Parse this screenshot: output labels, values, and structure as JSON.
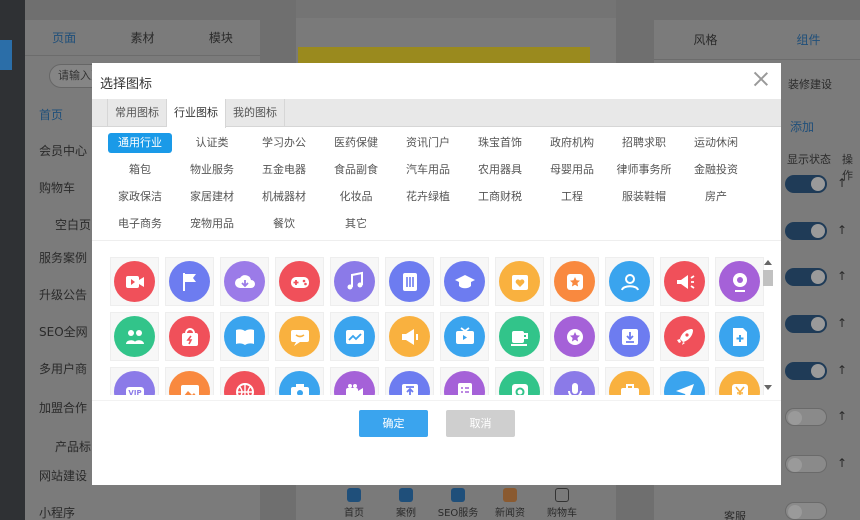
{
  "background": {
    "left_tabs": [
      "页面",
      "素材",
      "模块"
    ],
    "left_search": "请输入页",
    "left_items": [
      "首页",
      "会员中心",
      "购物车",
      "空白页",
      "服务案例",
      "升级公告",
      "SEO全网",
      "多用户商",
      "加盟合作",
      "产品标",
      "网站建设",
      "小程序"
    ],
    "right_tabs": [
      "风格",
      "组件"
    ],
    "right_items": [
      "添加",
      "显示状态",
      "操作",
      "装修建设",
      "客服"
    ],
    "bottom_nav": [
      "首页",
      "案例",
      "SEO服务",
      "新闻资",
      "购物车"
    ]
  },
  "modal": {
    "title": "选择图标",
    "close_icon": "close-icon",
    "tabs": [
      "常用图标",
      "行业图标",
      "我的图标"
    ],
    "active_tab": 1,
    "categories": [
      "通用行业",
      "认证类",
      "学习办公",
      "医药保健",
      "资讯门户",
      "珠宝首饰",
      "政府机构",
      "招聘求职",
      "运动休闲",
      "箱包",
      "物业服务",
      "五金电器",
      "食品副食",
      "汽车用品",
      "农用器具",
      "母婴用品",
      "律师事务所",
      "金融投资",
      "家政保洁",
      "家居建材",
      "机械器材",
      "化妆品",
      "花卉绿植",
      "工商财税",
      "工程",
      "服装鞋帽",
      "房产",
      "电子商务",
      "宠物用品",
      "餐饮",
      "其它"
    ],
    "active_category": 0,
    "icons": [
      {
        "name": "video-icon",
        "color": "#f0505a"
      },
      {
        "name": "flag-icon",
        "color": "#6d7cf0"
      },
      {
        "name": "cloud-icon",
        "color": "#9b7be8"
      },
      {
        "name": "gamepad-icon",
        "color": "#f0505a"
      },
      {
        "name": "music-icon",
        "color": "#8b7ae8"
      },
      {
        "name": "book-icon",
        "color": "#6d7cf0"
      },
      {
        "name": "graduation-cap-icon",
        "color": "#6d7cf0"
      },
      {
        "name": "heart-box-icon",
        "color": "#f9b13f"
      },
      {
        "name": "star-badge-icon",
        "color": "#f9893f"
      },
      {
        "name": "user-icon",
        "color": "#3aa4ee"
      },
      {
        "name": "megaphone-icon",
        "color": "#f0505a"
      },
      {
        "name": "webcam-icon",
        "color": "#a561d8"
      },
      {
        "name": "group-icon",
        "color": "#32c48a"
      },
      {
        "name": "shopping-bag-icon",
        "color": "#f0505a"
      },
      {
        "name": "open-book-icon",
        "color": "#3aa4ee"
      },
      {
        "name": "chat-bubble-icon",
        "color": "#f9b13f"
      },
      {
        "name": "trend-chart-icon",
        "color": "#3aa4ee"
      },
      {
        "name": "loudspeaker-icon",
        "color": "#f9b13f"
      },
      {
        "name": "tv-icon",
        "color": "#3aa4ee"
      },
      {
        "name": "cup-icon",
        "color": "#32c48a"
      },
      {
        "name": "star-circle-icon",
        "color": "#a561d8"
      },
      {
        "name": "download-icon",
        "color": "#6d7cf0"
      },
      {
        "name": "rocket-icon",
        "color": "#f0505a"
      },
      {
        "name": "add-file-icon",
        "color": "#3aa4ee"
      },
      {
        "name": "vip-icon",
        "color": "#8b7ae8"
      },
      {
        "name": "image-icon",
        "color": "#f9893f"
      },
      {
        "name": "basketball-icon",
        "color": "#f0505a"
      },
      {
        "name": "camera-icon",
        "color": "#3aa4ee"
      },
      {
        "name": "video-camera-icon",
        "color": "#a561d8"
      },
      {
        "name": "upload-icon",
        "color": "#6d7cf0"
      },
      {
        "name": "checklist-icon",
        "color": "#a561d8"
      },
      {
        "name": "photo-frame-icon",
        "color": "#32c48a"
      },
      {
        "name": "microphone-icon",
        "color": "#8b7ae8"
      },
      {
        "name": "briefcase-icon",
        "color": "#f9b13f"
      },
      {
        "name": "send-icon",
        "color": "#3aa4ee"
      },
      {
        "name": "yen-icon",
        "color": "#f9b13f"
      }
    ],
    "confirm_label": "确定",
    "cancel_label": "取消"
  }
}
